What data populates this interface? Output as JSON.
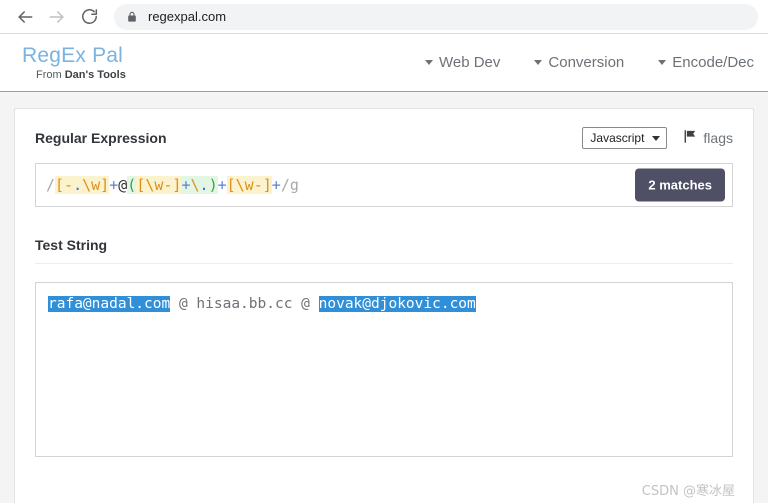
{
  "browser": {
    "back_icon": "back-arrow-icon",
    "forward_icon": "forward-arrow-icon",
    "reload_icon": "reload-icon",
    "lock_icon": "lock-icon",
    "url": "regexpal.com"
  },
  "site": {
    "brand_title": "RegEx Pal",
    "brand_sub_prefix": "From ",
    "brand_sub_strong": "Dan's Tools",
    "nav": [
      {
        "label": "Web Dev",
        "icon": "chevron-down-icon"
      },
      {
        "label": "Conversion",
        "icon": "chevron-down-icon"
      },
      {
        "label": "Encode/Dec",
        "icon": "chevron-down-icon"
      }
    ]
  },
  "regex_panel": {
    "title": "Regular Expression",
    "language_select": {
      "value": "Javascript",
      "icon": "chevron-down-icon",
      "options": [
        "Javascript"
      ]
    },
    "flags_button": {
      "label": "flags",
      "icon": "flag-icon"
    },
    "pattern_full": "/[-.\\w]+@([\\w-]+\\.)+[\\w-]+/g",
    "pattern_tokens": [
      {
        "text": "/",
        "kind": "slash"
      },
      {
        "text": "[-",
        "kind": "class"
      },
      {
        "text": ".",
        "kind": "class-dot"
      },
      {
        "text": "\\w]",
        "kind": "class"
      },
      {
        "text": "+",
        "kind": "quant"
      },
      {
        "text": "@",
        "kind": "literal"
      },
      {
        "text": "(",
        "kind": "group"
      },
      {
        "text": "[\\w-]",
        "kind": "class"
      },
      {
        "text": "+",
        "kind": "quant-group"
      },
      {
        "text": "\\",
        "kind": "esc"
      },
      {
        "text": ".",
        "kind": "esc-dot"
      },
      {
        "text": ")",
        "kind": "group"
      },
      {
        "text": "+",
        "kind": "quant"
      },
      {
        "text": "[\\w-]",
        "kind": "class"
      },
      {
        "text": "+",
        "kind": "quant"
      },
      {
        "text": "/g",
        "kind": "slash"
      }
    ],
    "matches_badge": "2 matches",
    "match_count": 2
  },
  "test_panel": {
    "title": "Test String",
    "segments": [
      {
        "text": "rafa@nadal.com",
        "match": true
      },
      {
        "text": " @ hisaa.bb.cc @ ",
        "match": false
      },
      {
        "text": "novak@djokovic.com",
        "match": true
      }
    ],
    "full_text": "rafa@nadal.com @ hisaa.bb.cc @ novak@djokovic.com"
  },
  "watermark": {
    "text": "CSDN @寒冰屋"
  },
  "colors": {
    "brand": "#7ab3e0",
    "header_border": "#6aaedd",
    "badge_bg": "#4f4f66",
    "match_highlight": "#2f8fd8",
    "class_token": "#e08f1a",
    "group_token": "#3aa349",
    "quant_token": "#5b7fd6"
  }
}
